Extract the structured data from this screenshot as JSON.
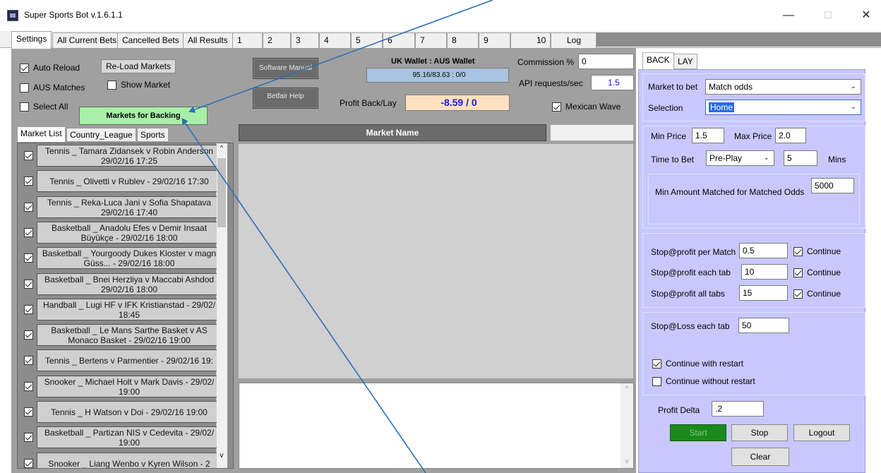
{
  "window": {
    "title": "Super Sports Bot v.1.6.1.1",
    "minimize": "—",
    "maximize": "☐",
    "close": "✕"
  },
  "tabs": [
    "Settings",
    "All Current Bets",
    "Cancelled Bets",
    "All Results",
    "1",
    "2",
    "3",
    "4",
    "5",
    "6",
    "7",
    "8",
    "9",
    "10",
    "Log"
  ],
  "controls": {
    "auto_reload": "Auto Reload",
    "aus_matches": "AUS Matches",
    "select_all": "Select All",
    "show_market": "Show Market",
    "reload_markets": "Re-Load Markets",
    "markets_for_backing": "Markets for Backing",
    "software_manual": "Software Manual",
    "betfair_help": "Betfair Help",
    "wallet_label": "UK Wallet : AUS Wallet",
    "wallet_value": "95.16/83.63  :  0/0",
    "profit_label": "Profit Back/Lay",
    "profit_value": "-8.59 / 0",
    "commission_label": "Commission %",
    "commission_value": "0",
    "api_label": "API requests/sec",
    "api_value": "1.5",
    "mexican_wave": "Mexican Wave"
  },
  "list_tabs": [
    "Market List",
    "Country_League",
    "Sports"
  ],
  "market_name_header": "Market Name",
  "markets": [
    [
      "Tennis _ Tamara Zidansek v Robin Anderson",
      "29/02/16 17:25"
    ],
    [
      "Tennis _ Olivetti v Rublev - 29/02/16 17:30"
    ],
    [
      "Tennis _ Reka-Luca Jani v Sofia Shapatava",
      "29/02/16 17:40"
    ],
    [
      "Basketball _ Anadolu Efes v Demir Insaat",
      "Büyükçe - 29/02/16 18:00"
    ],
    [
      "Basketball _ Yourgoody Dukes Kloster v magn",
      "Güss... - 29/02/16 18:00"
    ],
    [
      "Basketball _ Bnei Herzliya v Maccabi Ashdod",
      "29/02/16 18:00"
    ],
    [
      "Handball _ Lugi HF v IFK Kristianstad - 29/02/",
      "18:45"
    ],
    [
      "Basketball _ Le Mans Sarthe Basket v AS",
      "Monaco Basket - 29/02/16 19:00"
    ],
    [
      "Tennis _ Bertens v Parmentier - 29/02/16 19:"
    ],
    [
      "Snooker _ Michael Holt v Mark Davis - 29/02/",
      "19:00"
    ],
    [
      "Tennis _ H Watson v Doi - 29/02/16 19:00"
    ],
    [
      "Basketball _ Partizan NIS v Cedevita - 29/02/",
      "19:00"
    ],
    [
      "Snooker _ Liang Wenbo v Kyren Wilson - 2"
    ]
  ],
  "right_tabs": [
    "BACK",
    "LAY"
  ],
  "right": {
    "market_to_bet_label": "Market to bet",
    "market_to_bet_value": "Match odds",
    "selection_label": "Selection",
    "selection_value": "Home",
    "min_price_label": "Min Price",
    "min_price_value": "1.5",
    "max_price_label": "Max Price",
    "max_price_value": "2.0",
    "time_to_bet_label": "Time to Bet",
    "time_to_bet_value": "Pre-Play",
    "mins_value": "5",
    "mins_label": "Mins",
    "min_amount_label": "Min Amount Matched for Matched Odds",
    "min_amount_value": "5000",
    "stop_match_label": "Stop@profit per Match",
    "stop_match_value": "0.5",
    "stop_tab_label": "Stop@profit each tab",
    "stop_tab_value": "10",
    "stop_all_label": "Stop@profit all tabs",
    "stop_all_value": "15",
    "continue": "Continue",
    "stop_loss_label": "Stop@Loss each tab",
    "stop_loss_value": "50",
    "continue_restart": "Continue with restart",
    "continue_no_restart": "Continue without restart",
    "profit_delta_label": "Profit Delta",
    "profit_delta_value": ".2",
    "start": "Start",
    "stop": "Stop",
    "logout": "Logout",
    "clear": "Clear"
  },
  "colors": {
    "right_panel": "#c8c8ff",
    "markets_for_backing": "#a8f0a8",
    "profit_box": "#ffe0c0",
    "wallet_box": "#a8c4e0",
    "start_button": "#1a8a1a"
  }
}
